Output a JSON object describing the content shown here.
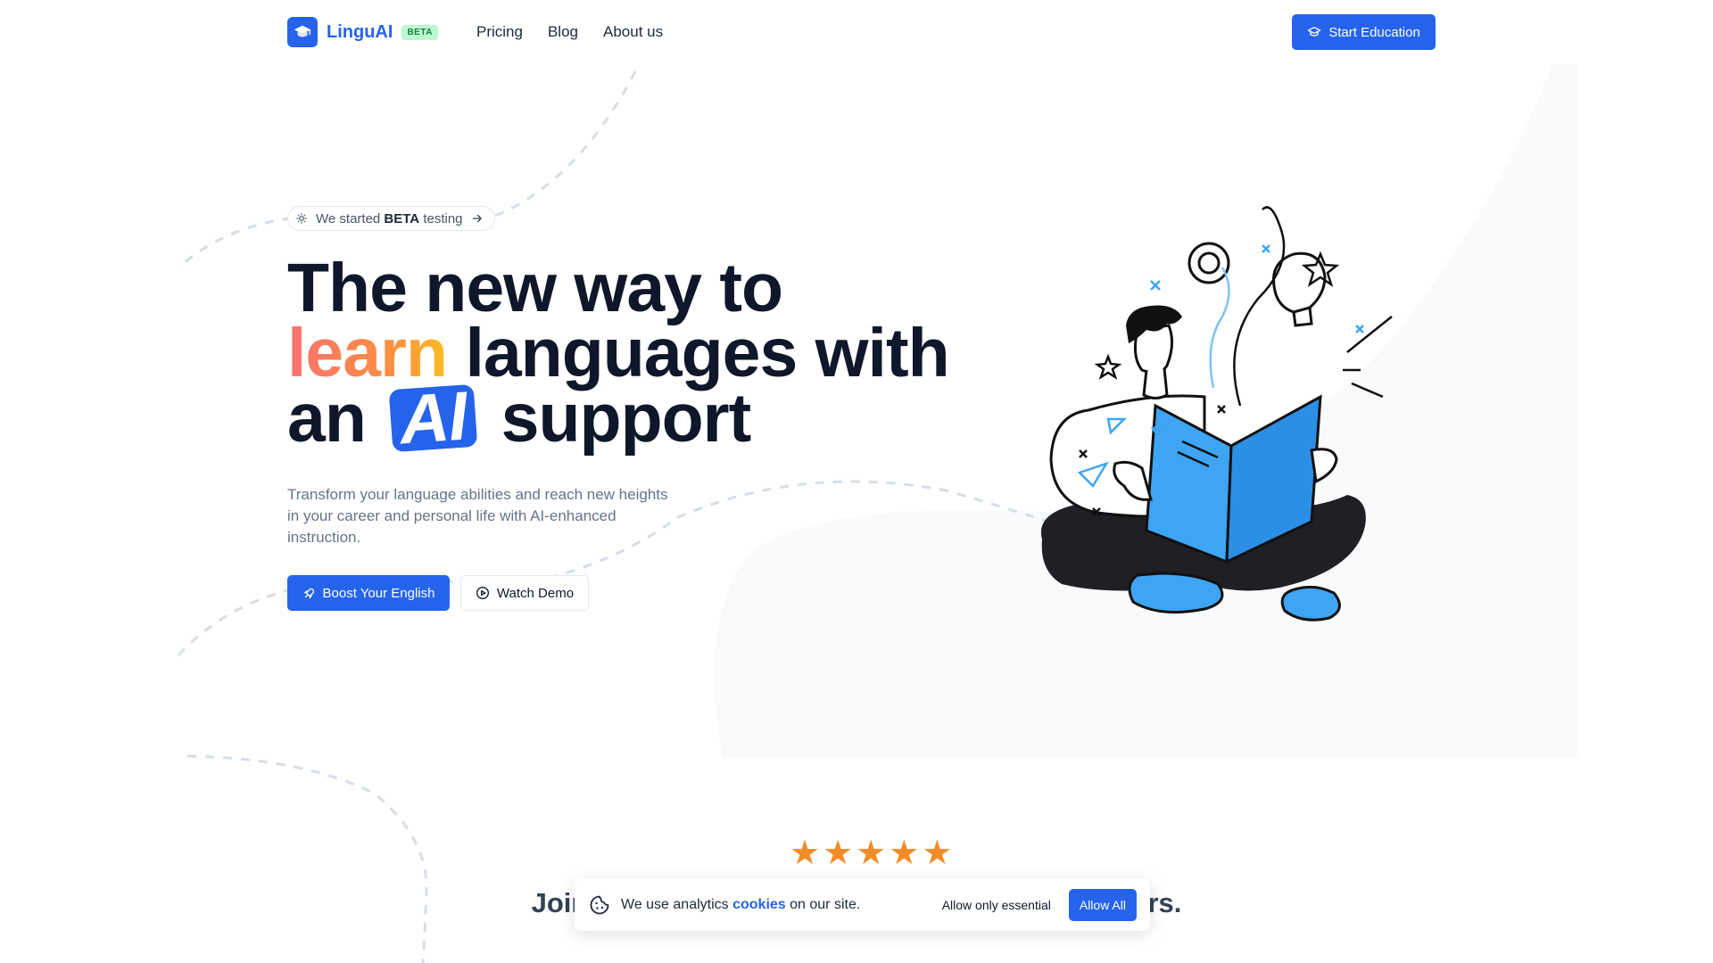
{
  "header": {
    "brand": "LinguAI",
    "brand_badge": "BETA",
    "nav": [
      "Pricing",
      "Blog",
      "About us"
    ],
    "cta": "Start Education"
  },
  "hero": {
    "pill_prefix": "We started ",
    "pill_bold": "BETA",
    "pill_suffix": " testing",
    "title_line1": "The new way to",
    "title_highlight": "learn",
    "title_line2_rest": " languages with",
    "title_line3_pre": "an",
    "title_ai": "AI",
    "title_line3_post": "support",
    "subtitle": "Transform your language abilities and reach new heights in your career and personal life with AI-enhanced instruction.",
    "primary_button": "Boost Your English",
    "secondary_button": "Watch Demo"
  },
  "rating": {
    "stars": 5,
    "join_left": "Join t",
    "join_right": "rners."
  },
  "cookie_banner": {
    "text_pre": "We use analytics ",
    "link": "cookies",
    "text_post": " on our site.",
    "essential_button": "Allow only essential",
    "allow_button": "Allow All"
  },
  "colors": {
    "primary": "#2563eb",
    "star": "#f28c28",
    "badge_green": "#bbf7d0",
    "title": "#0f172a"
  },
  "icons": [
    "graduation-cap-icon",
    "rocket-icon",
    "play-circle-icon",
    "arrow-right-icon",
    "sparkle-icon",
    "cookie-icon"
  ]
}
